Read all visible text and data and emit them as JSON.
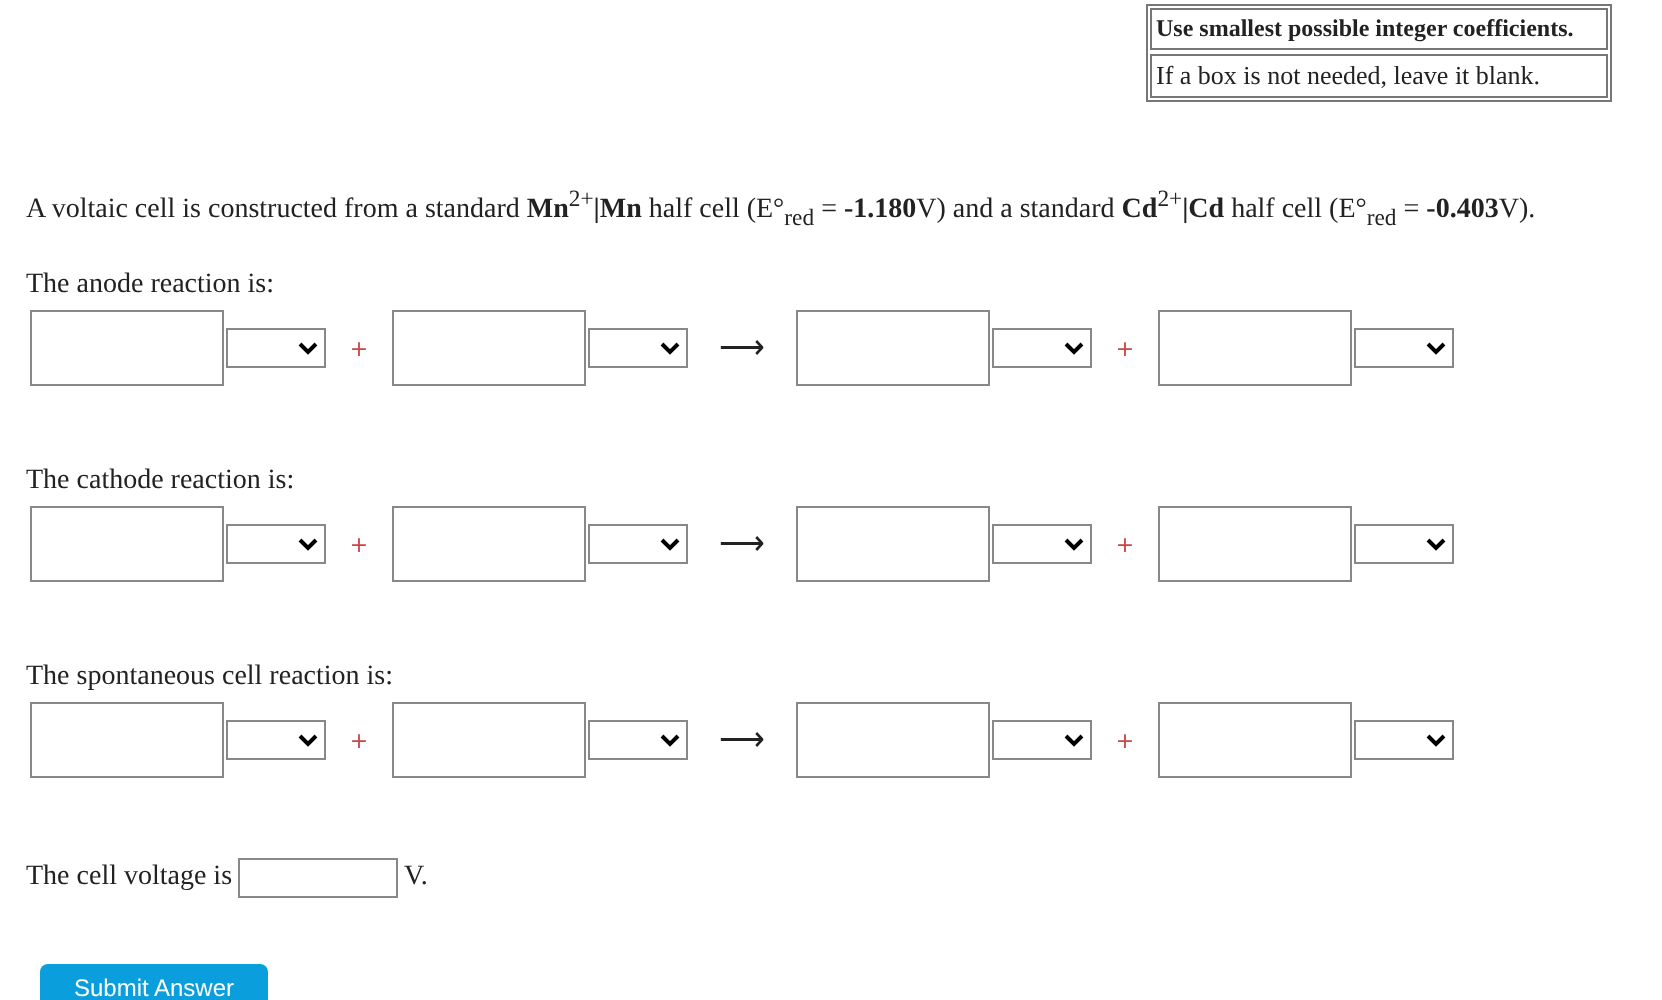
{
  "notes": [
    "Use smallest possible integer coefficients.",
    "If a box is not needed, leave it blank."
  ],
  "intro": "A voltaic cell is constructed from a standard **Mn**$^{2+}$**|Mn** half cell (E°$_{red}$ = **-1.180**V) and a standard **Cd**$^{2+}$**|Cd** half cell (E°$_{red}$ = **-0.403**V).",
  "reactions": [
    {
      "label": "The anode reaction is:",
      "parts": [
        {
          "kind": "species"
        },
        {
          "kind": "operator",
          "text": "+"
        },
        {
          "kind": "species"
        },
        {
          "kind": "arrow",
          "text": "⟶"
        },
        {
          "kind": "species"
        },
        {
          "kind": "operator",
          "text": "+"
        },
        {
          "kind": "species"
        }
      ]
    },
    {
      "label": "The cathode reaction is:",
      "parts": [
        {
          "kind": "species"
        },
        {
          "kind": "operator",
          "text": "+"
        },
        {
          "kind": "species"
        },
        {
          "kind": "arrow",
          "text": "⟶"
        },
        {
          "kind": "species"
        },
        {
          "kind": "operator",
          "text": "+"
        },
        {
          "kind": "species"
        }
      ]
    },
    {
      "label": "The spontaneous cell reaction is:",
      "parts": [
        {
          "kind": "species"
        },
        {
          "kind": "operator",
          "text": "+"
        },
        {
          "kind": "species"
        },
        {
          "kind": "arrow",
          "text": "⟶"
        },
        {
          "kind": "species"
        },
        {
          "kind": "operator",
          "text": "+"
        },
        {
          "kind": "species"
        }
      ]
    }
  ],
  "voltage": {
    "label": "The cell voltage is",
    "unit": "V."
  },
  "submit": "Submit Answer"
}
